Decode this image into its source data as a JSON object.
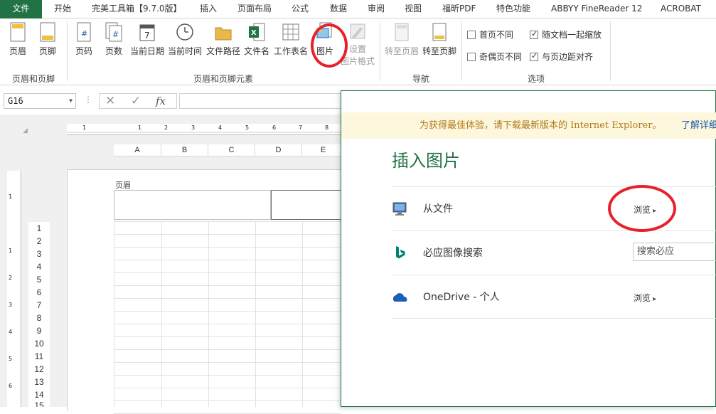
{
  "tabs": [
    "文件",
    "开始",
    "完美工具箱【9.7.0版】",
    "插入",
    "页面布局",
    "公式",
    "数据",
    "审阅",
    "视图",
    "福昕PDF",
    "特色功能",
    "ABBYY FineReader 12",
    "ACROBAT"
  ],
  "ribbon": {
    "header_footer": {
      "header": "页眉",
      "footer": "页脚",
      "group_label": "页眉和页脚"
    },
    "elements": {
      "page_number": "页码",
      "page_count": "页数",
      "current_date": "当前日期",
      "current_time": "当前时间",
      "file_path": "文件路径",
      "file_name": "文件名",
      "sheet_name": "工作表名",
      "picture": "图片",
      "format_picture_1": "设置",
      "format_picture_2": "图片格式",
      "group_label": "页眉和页脚元素"
    },
    "navigation": {
      "goto_header": "转至页眉",
      "goto_footer": "转至页脚",
      "group_label": "导航"
    },
    "options": {
      "different_first_page": {
        "label": "首页不同",
        "checked": false
      },
      "scale_with_document": {
        "label": "随文档一起缩放",
        "checked": true
      },
      "different_odd_even": {
        "label": "奇偶页不同",
        "checked": false
      },
      "align_with_margins": {
        "label": "与页边距对齐",
        "checked": true
      },
      "group_label": "选项"
    }
  },
  "formula_bar": {
    "name_box": "G16",
    "fx": "fx",
    "cancel": "✕",
    "enter": "✓"
  },
  "sheet": {
    "columns": [
      "A",
      "B",
      "C",
      "D",
      "E"
    ],
    "rows": [
      "1",
      "2",
      "3",
      "4",
      "5",
      "6",
      "7",
      "8",
      "9",
      "10",
      "11",
      "12",
      "13",
      "14",
      "15"
    ],
    "header_label": "页眉",
    "ruler_numbers": [
      "1",
      "1",
      "2",
      "3",
      "4",
      "5",
      "6",
      "7",
      "8"
    ],
    "vruler_numbers": [
      "1",
      "1",
      "2",
      "3",
      "4",
      "5",
      "6"
    ]
  },
  "dialog": {
    "notice": "为获得最佳体验，请下载最新版本的 Internet Explorer。",
    "notice_link": "了解详细",
    "title": "插入图片",
    "from_file": {
      "label": "从文件",
      "action": "浏览"
    },
    "bing": {
      "label": "必应图像搜索",
      "placeholder": "搜索必应"
    },
    "onedrive": {
      "label": "OneDrive - 个人",
      "action": "浏览"
    }
  },
  "colors": {
    "accent": "#217346",
    "annotation": "#e8202a",
    "notice_bg": "#fdf7dd",
    "link": "#1e5aa8"
  }
}
